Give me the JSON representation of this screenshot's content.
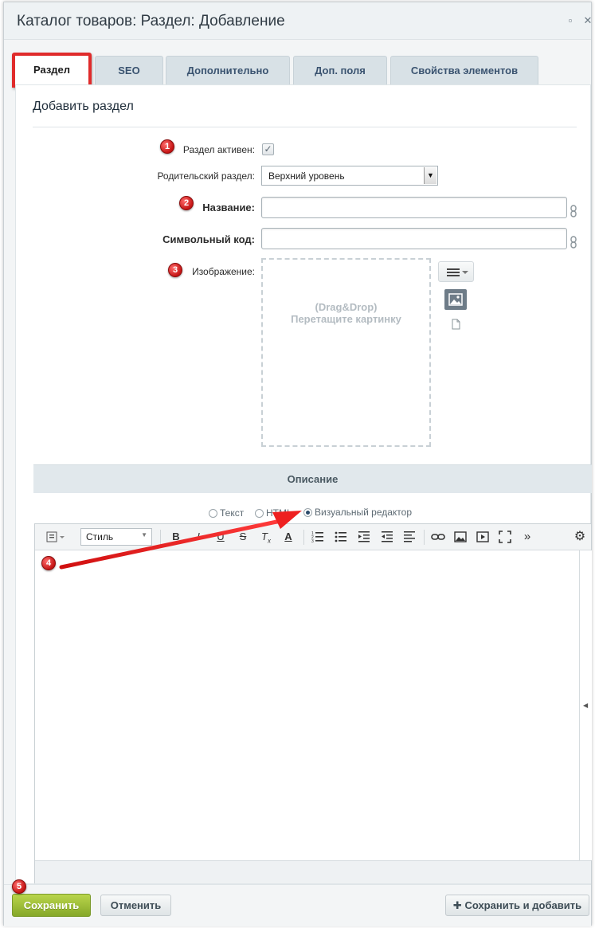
{
  "window": {
    "title": "Каталог товаров: Раздел: Добавление"
  },
  "tabs": [
    {
      "label": "Раздел"
    },
    {
      "label": "SEO"
    },
    {
      "label": "Дополнительно"
    },
    {
      "label": "Доп. поля"
    },
    {
      "label": "Свойства элементов"
    }
  ],
  "form": {
    "heading": "Добавить раздел",
    "active_label": "Раздел активен:",
    "active_checked": true,
    "parent_label": "Родительский раздел:",
    "parent_value": "Верхний уровень",
    "name_label": "Название:",
    "name_value": "",
    "code_label": "Символьный код:",
    "code_value": "",
    "image_label": "Изображение:",
    "dropzone_line1": "(Drag&Drop)",
    "dropzone_line2": "Перетащите картинку"
  },
  "description": {
    "header": "Описание",
    "modes": [
      "Текст",
      "HTML",
      "Визуальный редактор"
    ],
    "selected_mode": "Визуальный редактор",
    "style_label": "Стиль"
  },
  "markers": [
    "1",
    "2",
    "3",
    "4",
    "5"
  ],
  "footer": {
    "save": "Сохранить",
    "cancel": "Отменить",
    "save_add": "Сохранить и добавить"
  },
  "colors": {
    "highlight": "#e02b2b",
    "save_green": "#86a829",
    "tab_bg": "#d8e1e6"
  }
}
